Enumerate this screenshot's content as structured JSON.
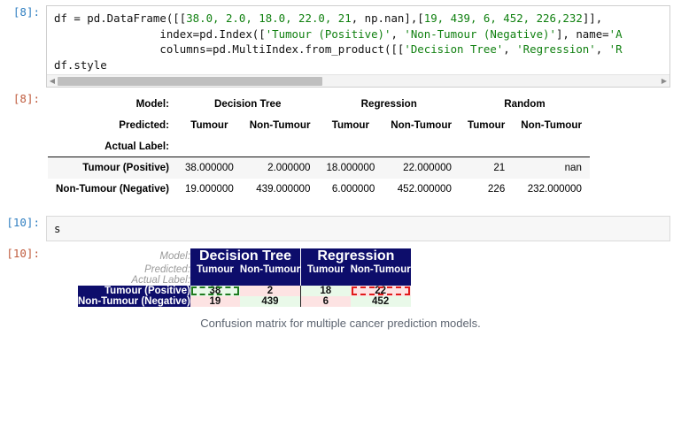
{
  "notebook": {
    "cell1": {
      "prompt_in": "[8]:",
      "prompt_out": "[8]:",
      "code_line1_a": "df = pd.DataFrame([[",
      "code_line1_nums": "38.0, 2.0, 18.0, 22.0, 21",
      "code_line1_b": ", np.nan],[",
      "code_line1_nums2": "19, 439, 6, 452, 226,232",
      "code_line1_c": "]],",
      "code_line2_a": "                index=pd.Index([",
      "code_line2_s1": "'Tumour (Positive)'",
      "code_line2_b": ", ",
      "code_line2_s2": "'Non-Tumour (Negative)'",
      "code_line2_c": "], name=",
      "code_line2_s3": "'A",
      "code_line3_a": "                columns=pd.MultiIndex.from_product([[",
      "code_line3_s1": "'Decision Tree'",
      "code_line3_b": ", ",
      "code_line3_s2": "'Regression'",
      "code_line3_c": ", ",
      "code_line3_s3": "'R",
      "code_line4": "df.style",
      "scroll_left_arrow": "◀",
      "scroll_right_arrow": "▶"
    },
    "cell2": {
      "prompt_in": "[10]:",
      "prompt_out": "[10]:",
      "code_line1": "s"
    }
  },
  "plain_table": {
    "header_labels": {
      "model": "Model:",
      "predicted": "Predicted:",
      "actual": "Actual Label:"
    },
    "models": [
      "Decision Tree",
      "Regression",
      "Random"
    ],
    "predicted": [
      "Tumour",
      "Non-Tumour",
      "Tumour",
      "Non-Tumour",
      "Tumour",
      "Non-Tumour"
    ],
    "rows": [
      {
        "label": "Tumour (Positive)",
        "values": [
          "38.000000",
          "2.000000",
          "18.000000",
          "22.000000",
          "21",
          "nan"
        ]
      },
      {
        "label": "Non-Tumour (Negative)",
        "values": [
          "19.000000",
          "439.000000",
          "6.000000",
          "452.000000",
          "226",
          "232.000000"
        ]
      }
    ]
  },
  "styled_table": {
    "header_labels": {
      "model": "Model:",
      "predicted": "Predicted:",
      "actual": "Actual Label:"
    },
    "models": [
      "Decision Tree",
      "Regression"
    ],
    "predicted": [
      "Tumour",
      "Non-Tumour",
      "Tumour",
      "Non-Tumour"
    ],
    "rows": [
      {
        "label": "Tumour (Positive)",
        "values": [
          "38",
          "2",
          "18",
          "22"
        ]
      },
      {
        "label": "Non-Tumour (Negative)",
        "values": [
          "19",
          "439",
          "6",
          "452"
        ]
      }
    ],
    "colors": {
      "header_navy": "#0d0d6b",
      "cell_green": "#e9f9e9",
      "cell_pink": "#fde3e3",
      "highlight_green": "#1e7a1e",
      "highlight_red": "#e01b1b"
    }
  },
  "caption": "Confusion matrix for multiple cancer prediction models."
}
